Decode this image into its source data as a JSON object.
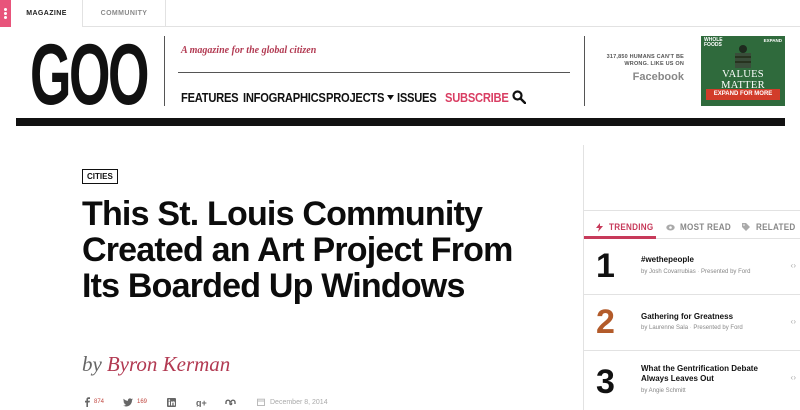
{
  "topbar": {
    "tabs": [
      {
        "label": "MAGAZINE",
        "active": true
      },
      {
        "label": "COMMUNITY",
        "active": false
      }
    ]
  },
  "header": {
    "logo": "GOOD",
    "tagline": "A magazine for the global citizen",
    "nav": [
      {
        "label": "FEATURES"
      },
      {
        "label": "INFOGRAPHICS"
      },
      {
        "label": "PROJECTS",
        "dropdown": true
      },
      {
        "label": "ISSUES"
      },
      {
        "label": "SUBSCRIBE",
        "color": "#d93e63"
      }
    ],
    "search_icon": "search-icon",
    "social": {
      "line1": "317,850 HUMANS CAN'T BE",
      "line2": "WRONG. LIKE US ON",
      "network": "Facebook"
    }
  },
  "ad": {
    "brand_line1": "WHOLE",
    "brand_line2": "FOODS",
    "expand_top": "EXPAND",
    "title": "VALUES MATTER",
    "cta": "EXPAND FOR MORE"
  },
  "article": {
    "category": "CITIES",
    "headline": "This St. Louis Community Created an Art Project From Its Boarded Up Windows",
    "byline_prefix": "by",
    "author": "Byron Kerman",
    "share": {
      "facebook_count": "874",
      "twitter_count": "169",
      "date": "December 8, 2014"
    }
  },
  "sidebar": {
    "tabs": [
      {
        "label": "TRENDING",
        "active": true,
        "icon": "lightning-icon"
      },
      {
        "label": "MOST READ",
        "active": false,
        "icon": "eye-icon"
      },
      {
        "label": "RELATED",
        "active": false,
        "icon": "tag-icon"
      }
    ],
    "items": [
      {
        "rank": "1",
        "title": "#wethepeople",
        "author": "by Josh Covarrubias",
        "sponsor": "Presented by Ford"
      },
      {
        "rank": "2",
        "title": "Gathering for Greatness",
        "author": "by Laurenne Sala",
        "sponsor": "Presented by Ford"
      },
      {
        "rank": "3",
        "title": "What the Gentrification Debate Always Leaves Out",
        "author": "by Angie Schmitt",
        "sponsor": ""
      }
    ],
    "share_arrows": "‹ ›"
  },
  "colors": {
    "accent_pink": "#d93e63",
    "byline": "#b23a52",
    "ad_green": "#2f6a3c",
    "ad_red": "#d23c2a"
  }
}
